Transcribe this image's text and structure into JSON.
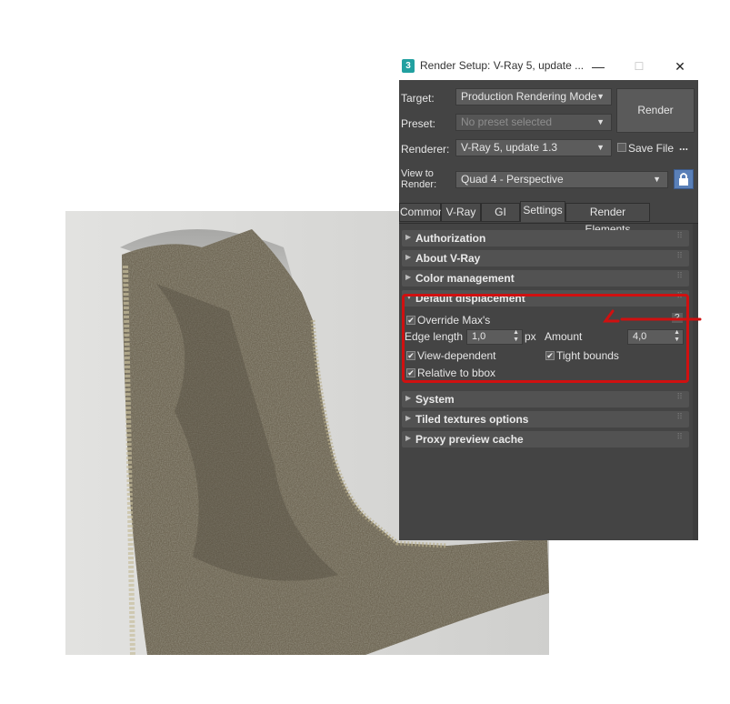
{
  "window": {
    "app_icon": "3",
    "title": "Render Setup: V-Ray 5, update ...",
    "minimize_icon": "—",
    "maximize_icon": "☐",
    "close_icon": "✕"
  },
  "header": {
    "target_label": "Target:",
    "target_value": "Production Rendering Mode",
    "preset_label": "Preset:",
    "preset_value": "No preset selected",
    "renderer_label": "Renderer:",
    "renderer_value": "V-Ray 5, update 1.3",
    "view_label_1": "View to",
    "view_label_2": "Render:",
    "view_value": "Quad 4 - Perspective",
    "render_button": "Render",
    "save_file_label": "Save File",
    "more_button": "...",
    "lock_icon": "lock-icon"
  },
  "tabs": [
    {
      "label": "Common"
    },
    {
      "label": "V-Ray"
    },
    {
      "label": "GI"
    },
    {
      "label": "Settings",
      "active": true
    },
    {
      "label": "Render Elements"
    }
  ],
  "rollouts": {
    "authorization": "Authorization",
    "about": "About V-Ray",
    "color_management": "Color management",
    "default_displacement": "Default displacement",
    "system": "System",
    "tiled_textures": "Tiled textures options",
    "proxy_cache": "Proxy preview cache"
  },
  "displacement": {
    "override_label": "Override Max's",
    "override_checked": true,
    "help_button": "?",
    "edge_length_label": "Edge length",
    "edge_length_value": "1,0",
    "edge_length_unit": "px",
    "amount_label": "Amount",
    "amount_value": "4,0",
    "view_dependent_label": "View-dependent",
    "view_dependent_checked": true,
    "tight_bounds_label": "Tight bounds",
    "tight_bounds_checked": true,
    "relative_bbox_label": "Relative to bbox",
    "relative_bbox_checked": true
  },
  "colors": {
    "dialog_bg": "#444444",
    "highlight": "#d01010",
    "lock_blue": "#5a80b8"
  }
}
